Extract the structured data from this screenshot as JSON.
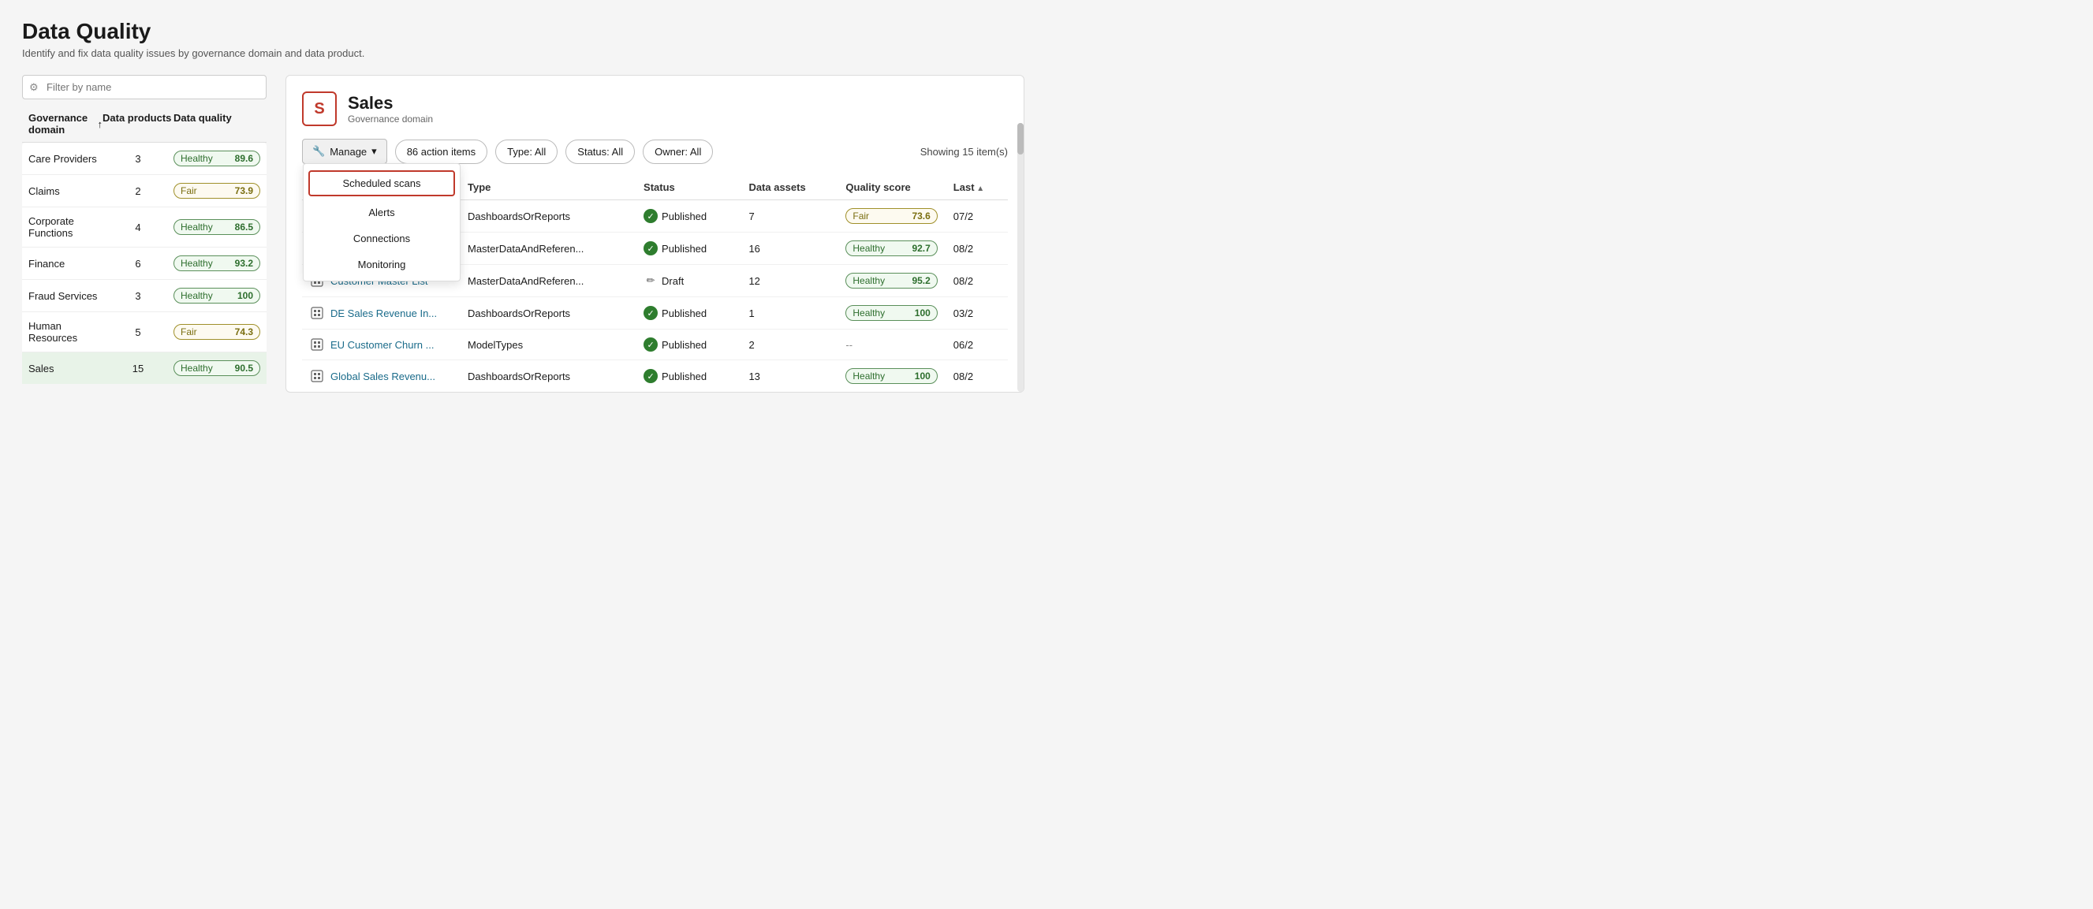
{
  "page": {
    "title": "Data Quality",
    "subtitle": "Identify and fix data quality issues by governance domain and data product.",
    "filter_placeholder": "Filter by name"
  },
  "left_table": {
    "col_domain": "Governance domain",
    "col_sort_icon": "↑",
    "col_products": "Data products",
    "col_quality": "Data quality",
    "rows": [
      {
        "domain": "Care Providers",
        "products": "3",
        "quality_label": "Healthy",
        "quality_score": "89.6",
        "status": "healthy"
      },
      {
        "domain": "Claims",
        "products": "2",
        "quality_label": "Fair",
        "quality_score": "73.9",
        "status": "fair"
      },
      {
        "domain": "Corporate Functions",
        "products": "4",
        "quality_label": "Healthy",
        "quality_score": "86.5",
        "status": "healthy"
      },
      {
        "domain": "Finance",
        "products": "6",
        "quality_label": "Healthy",
        "quality_score": "93.2",
        "status": "healthy"
      },
      {
        "domain": "Fraud Services",
        "products": "3",
        "quality_label": "Healthy",
        "quality_score": "100",
        "status": "healthy"
      },
      {
        "domain": "Human Resources",
        "products": "5",
        "quality_label": "Fair",
        "quality_score": "74.3",
        "status": "fair"
      },
      {
        "domain": "Sales",
        "products": "15",
        "quality_label": "Healthy",
        "quality_score": "90.5",
        "status": "healthy",
        "selected": true
      }
    ]
  },
  "right_panel": {
    "domain_letter": "S",
    "domain_name": "Sales",
    "domain_type": "Governance domain",
    "toolbar": {
      "manage_label": "Manage",
      "action_items_label": "86 action items",
      "filter_type_label": "Type: All",
      "filter_status_label": "Status: All",
      "filter_owner_label": "Owner: All",
      "showing_label": "Showing 15 item(s)"
    },
    "dropdown": {
      "items": [
        {
          "label": "Scheduled scans",
          "highlighted": true
        },
        {
          "label": "Alerts",
          "highlighted": false
        },
        {
          "label": "Connections",
          "highlighted": false
        },
        {
          "label": "Monitoring",
          "highlighted": false
        }
      ]
    },
    "table": {
      "columns": [
        "",
        "Type",
        "Status",
        "Data assets",
        "Quality score",
        "Last"
      ],
      "rows": [
        {
          "name": "",
          "icon": "📦",
          "type": "DashboardsOrReports",
          "status": "Published",
          "status_type": "published",
          "data_assets": "7",
          "quality_label": "Fair",
          "quality_score": "73.6",
          "quality_status": "fair",
          "last": "07/2"
        },
        {
          "name": "",
          "icon": "📦",
          "type": "MasterDataAndReferen...",
          "status": "Published",
          "status_type": "published",
          "data_assets": "16",
          "quality_label": "Healthy",
          "quality_score": "92.7",
          "quality_status": "healthy",
          "last": "08/2"
        },
        {
          "name": "Customer Master List",
          "icon": "📦",
          "type": "MasterDataAndReferen...",
          "status": "Draft",
          "status_type": "draft",
          "data_assets": "12",
          "quality_label": "Healthy",
          "quality_score": "95.2",
          "quality_status": "healthy",
          "last": "08/2"
        },
        {
          "name": "DE Sales Revenue In...",
          "icon": "📦",
          "type": "DashboardsOrReports",
          "status": "Published",
          "status_type": "published",
          "data_assets": "1",
          "quality_label": "Healthy",
          "quality_score": "100",
          "quality_status": "healthy",
          "last": "03/2"
        },
        {
          "name": "EU Customer Churn ...",
          "icon": "📦",
          "type": "ModelTypes",
          "status": "Published",
          "status_type": "published",
          "data_assets": "2",
          "quality_label": "--",
          "quality_score": "",
          "quality_status": "none",
          "last": "06/2"
        },
        {
          "name": "Global Sales Revenu...",
          "icon": "📦",
          "type": "DashboardsOrReports",
          "status": "Published",
          "status_type": "published",
          "data_assets": "13",
          "quality_label": "Healthy",
          "quality_score": "100",
          "quality_status": "healthy",
          "last": "08/2"
        }
      ]
    }
  }
}
